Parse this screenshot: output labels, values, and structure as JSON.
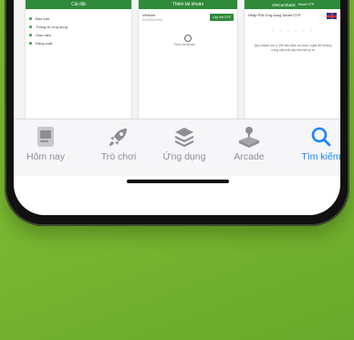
{
  "screenshots": {
    "settings": {
      "title": "Cài đặt",
      "items": [
        "Bảo mật",
        "Thông tin ứng dụng",
        "Giao diện",
        "Đăng xuất"
      ]
    },
    "accounts": {
      "title": "Thêm tài khoản",
      "account_label": "Vietcom",
      "account_sub": "0000000000",
      "otp_button": "Lấy mã OTP",
      "add_label": "Thêm tài khoản"
    },
    "otp": {
      "brand": "Vietcombank",
      "brand_sub": "Smart OTP",
      "title": "Nhập PIN Ứng dụng Smart OTP",
      "code": "- - - - - -",
      "note": "Quý khách lưu ý: Để bảo đảm an toàn, tuyệt đối không cung cấp mã này cho bất kỳ ai"
    }
  },
  "tabbar": {
    "tabs": [
      {
        "label": "Hôm nay",
        "icon": "today-icon",
        "active": false
      },
      {
        "label": "Trò chơi",
        "icon": "rocket-icon",
        "active": false
      },
      {
        "label": "Ứng dụng",
        "icon": "apps-layers-icon",
        "active": false
      },
      {
        "label": "Arcade",
        "icon": "joystick-icon",
        "active": false
      },
      {
        "label": "Tìm kiếm",
        "icon": "search-icon",
        "active": true
      }
    ]
  },
  "colors": {
    "background": "#7ab832",
    "accent": "#1a84ff",
    "inactive": "#8e8e93",
    "vcb_green": "#2f8a3a"
  }
}
